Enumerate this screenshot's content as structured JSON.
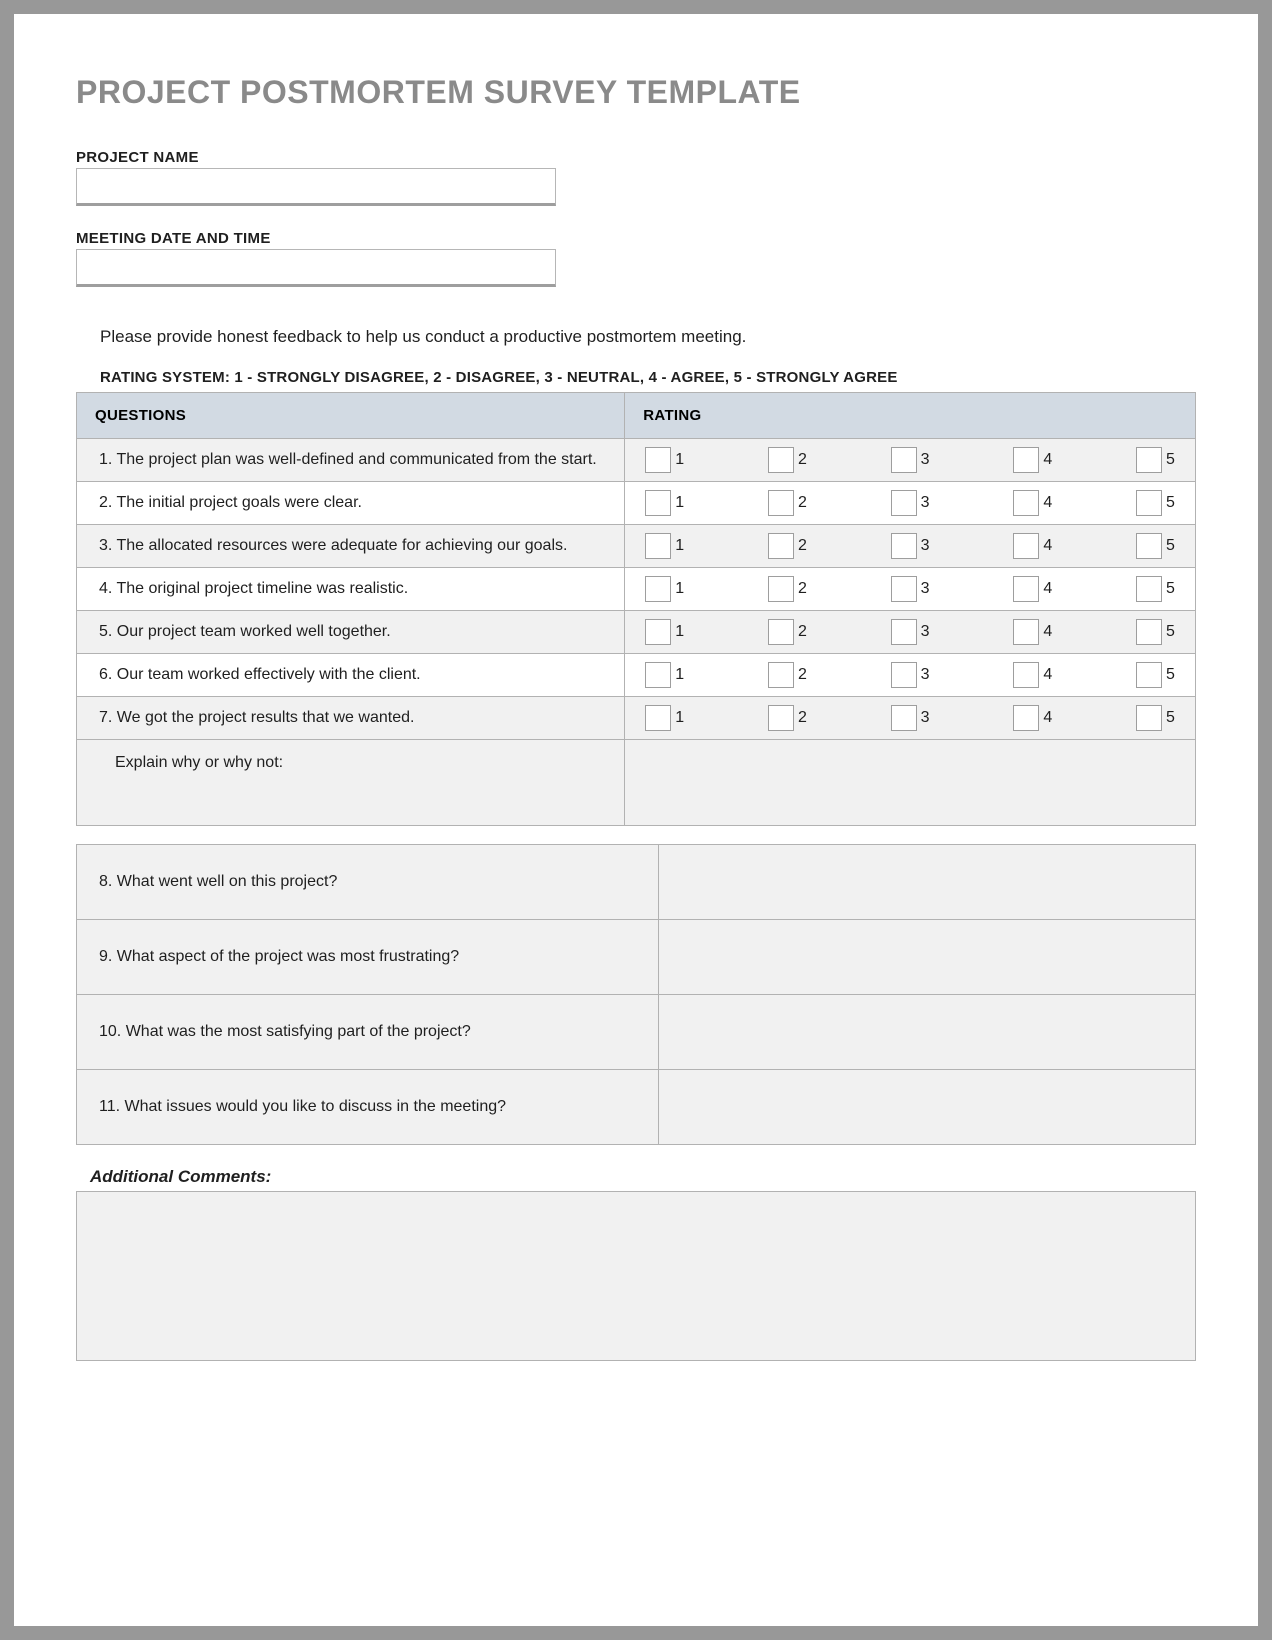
{
  "title": "PROJECT POSTMORTEM SURVEY TEMPLATE",
  "fields": {
    "project_name_label": "PROJECT NAME",
    "project_name_value": "",
    "meeting_label": "MEETING DATE AND TIME",
    "meeting_value": ""
  },
  "instructions": "Please provide honest feedback to help us conduct a productive postmortem meeting.",
  "rating_legend": "RATING SYSTEM: 1 - STRONGLY DISAGREE, 2 - DISAGREE, 3 - NEUTRAL, 4 - AGREE, 5 - STRONGLY AGREE",
  "headers": {
    "questions": "QUESTIONS",
    "rating": "RATING"
  },
  "rating_values": [
    "1",
    "2",
    "3",
    "4",
    "5"
  ],
  "questions": {
    "q1": "1. The project plan was well-defined and communicated from the start.",
    "q2": "2. The initial project goals were clear.",
    "q3": "3. The allocated resources were adequate for achieving our goals.",
    "q4": "4. The original project timeline was realistic.",
    "q5": "5. Our project team worked well together.",
    "q6": "6. Our team worked effectively with the client.",
    "q7": "7. We got the project results that we wanted.",
    "explain": "Explain why or why not:"
  },
  "open_questions": {
    "q8": "8. What went well on this project?",
    "q9": "9. What aspect of the project was most frustrating?",
    "q10": "10. What was the most satisfying part of the project?",
    "q11": "11. What issues would you like to discuss in the meeting?"
  },
  "comments_label": "Additional Comments:",
  "comments_value": ""
}
